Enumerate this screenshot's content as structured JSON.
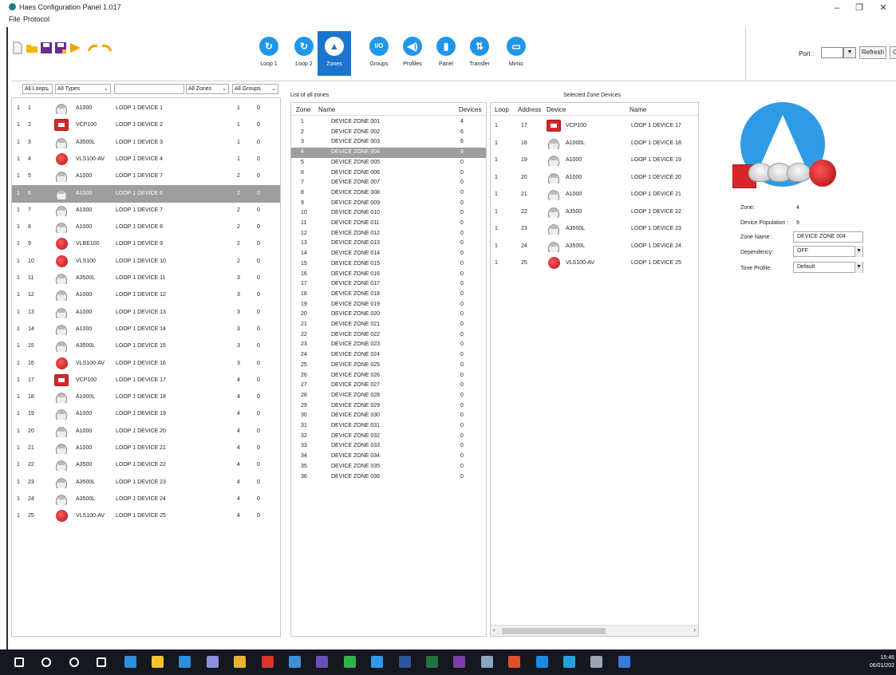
{
  "window": {
    "title": "Haes Configuration Panel 1.017",
    "minimize": "–",
    "maximize": "❐",
    "close": "✕"
  },
  "menu": [
    "File",
    "Protocol"
  ],
  "toolbar": {
    "nav": [
      {
        "label": "Loop 1",
        "icon": "refresh-icon",
        "glyph": "↻",
        "active": false
      },
      {
        "label": "Loop 2",
        "icon": "refresh-icon",
        "glyph": "↻",
        "active": false
      },
      {
        "label": "Zones",
        "icon": "triangle-icon",
        "glyph": "▲",
        "active": true
      },
      {
        "label": "Groups",
        "icon": "io-icon",
        "glyph": "I/O",
        "active": false
      },
      {
        "label": "Profiles",
        "icon": "speaker-icon",
        "glyph": "◀)",
        "active": false
      },
      {
        "label": "Panel",
        "icon": "panel-icon",
        "glyph": "▮",
        "active": false
      },
      {
        "label": "Transfer",
        "icon": "transfer-icon",
        "glyph": "⇅",
        "active": false
      },
      {
        "label": "Mimic",
        "icon": "mimic-icon",
        "glyph": "▭",
        "active": false
      }
    ],
    "port_label": "Port :",
    "port_value": "",
    "refresh_label": "Refresh",
    "connect_label": "Connect"
  },
  "filters": {
    "loops": "All Loops",
    "types": "All Types",
    "search": "",
    "zones": "All Zones",
    "groups": "All Groups"
  },
  "devices": [
    {
      "loop": "1",
      "address": "1",
      "type": "A1000",
      "icon": "detector",
      "name": "LOOP 1 DEVICE 1",
      "zone": "1",
      "group": "0"
    },
    {
      "loop": "1",
      "address": "2",
      "type": "VCP100",
      "icon": "callpoint",
      "name": "LOOP 1 DEVICE 2",
      "zone": "1",
      "group": "0"
    },
    {
      "loop": "1",
      "address": "3",
      "type": "A3500L",
      "icon": "detector",
      "name": "LOOP 1 DEVICE 3",
      "zone": "1",
      "group": "0"
    },
    {
      "loop": "1",
      "address": "4",
      "type": "VLS100-AV",
      "icon": "siren",
      "name": "LOOP 1 DEVICE 4",
      "zone": "1",
      "group": "0"
    },
    {
      "loop": "1",
      "address": "5",
      "type": "A1000",
      "icon": "detector",
      "name": "LOOP 1 DEVICE 7",
      "zone": "2",
      "group": "0"
    },
    {
      "loop": "1",
      "address": "6",
      "type": "A1000",
      "icon": "detector",
      "name": "LOOP 1 DEVICE 6",
      "zone": "2",
      "group": "0",
      "selected": true
    },
    {
      "loop": "1",
      "address": "7",
      "type": "A1000",
      "icon": "detector",
      "name": "LOOP 1 DEVICE 7",
      "zone": "2",
      "group": "0"
    },
    {
      "loop": "1",
      "address": "8",
      "type": "A1000",
      "icon": "detector",
      "name": "LOOP 1 DEVICE 8",
      "zone": "2",
      "group": "0"
    },
    {
      "loop": "1",
      "address": "9",
      "type": "VLBE100",
      "icon": "siren",
      "name": "LOOP 1 DEVICE 9",
      "zone": "2",
      "group": "0"
    },
    {
      "loop": "1",
      "address": "10",
      "type": "VLS100",
      "icon": "siren",
      "name": "LOOP 1 DEVICE 10",
      "zone": "2",
      "group": "0"
    },
    {
      "loop": "1",
      "address": "11",
      "type": "A3500L",
      "icon": "detector",
      "name": "LOOP 1 DEVICE 11",
      "zone": "3",
      "group": "0"
    },
    {
      "loop": "1",
      "address": "12",
      "type": "A1000",
      "icon": "detector",
      "name": "LOOP 1 DEVICE 12",
      "zone": "3",
      "group": "0"
    },
    {
      "loop": "1",
      "address": "13",
      "type": "A1000",
      "icon": "detector",
      "name": "LOOP 1 DEVICE 13",
      "zone": "3",
      "group": "0"
    },
    {
      "loop": "1",
      "address": "14",
      "type": "A1000",
      "icon": "detector",
      "name": "LOOP 1 DEVICE 14",
      "zone": "3",
      "group": "0"
    },
    {
      "loop": "1",
      "address": "15",
      "type": "A3500L",
      "icon": "detector",
      "name": "LOOP 1 DEVICE 15",
      "zone": "3",
      "group": "0"
    },
    {
      "loop": "1",
      "address": "16",
      "type": "VLS100-AV",
      "icon": "siren",
      "name": "LOOP 1 DEVICE 16",
      "zone": "3",
      "group": "0"
    },
    {
      "loop": "1",
      "address": "17",
      "type": "VCP100",
      "icon": "callpoint",
      "name": "LOOP 1 DEVICE 17",
      "zone": "4",
      "group": "0"
    },
    {
      "loop": "1",
      "address": "18",
      "type": "A1000L",
      "icon": "detector",
      "name": "LOOP 1 DEVICE 18",
      "zone": "4",
      "group": "0"
    },
    {
      "loop": "1",
      "address": "19",
      "type": "A1000",
      "icon": "detector",
      "name": "LOOP 1 DEVICE 19",
      "zone": "4",
      "group": "0"
    },
    {
      "loop": "1",
      "address": "20",
      "type": "A1000",
      "icon": "detector",
      "name": "LOOP 1 DEVICE 20",
      "zone": "4",
      "group": "0"
    },
    {
      "loop": "1",
      "address": "21",
      "type": "A1000",
      "icon": "detector",
      "name": "LOOP 1 DEVICE 21",
      "zone": "4",
      "group": "0"
    },
    {
      "loop": "1",
      "address": "22",
      "type": "A3500",
      "icon": "detector",
      "name": "LOOP 1 DEVICE 22",
      "zone": "4",
      "group": "0"
    },
    {
      "loop": "1",
      "address": "23",
      "type": "A3500L",
      "icon": "detector",
      "name": "LOOP 1 DEVICE 23",
      "zone": "4",
      "group": "0"
    },
    {
      "loop": "1",
      "address": "24",
      "type": "A3500L",
      "icon": "detector",
      "name": "LOOP 1 DEVICE 24",
      "zone": "4",
      "group": "0"
    },
    {
      "loop": "1",
      "address": "25",
      "type": "VLS100-AV",
      "icon": "siren",
      "name": "LOOP 1 DEVICE 25",
      "zone": "4",
      "group": "0"
    }
  ],
  "zones": {
    "caption": "List of all zones",
    "headers": {
      "zone": "Zone",
      "name": "Name",
      "devices": "Devices"
    },
    "selected_index": 3,
    "rows": [
      {
        "zone": "1",
        "name": "DEVICE ZONE 001",
        "devices": "4"
      },
      {
        "zone": "2",
        "name": "DEVICE ZONE 002",
        "devices": "6"
      },
      {
        "zone": "3",
        "name": "DEVICE ZONE 003",
        "devices": "6"
      },
      {
        "zone": "4",
        "name": "DEVICE ZONE 004",
        "devices": "9"
      },
      {
        "zone": "5",
        "name": "DEVICE ZONE 005",
        "devices": "0"
      },
      {
        "zone": "6",
        "name": "DEVICE ZONE 006",
        "devices": "0"
      },
      {
        "zone": "7",
        "name": "DEVICE ZONE 007",
        "devices": "0"
      },
      {
        "zone": "8",
        "name": "DEVICE ZONE 008",
        "devices": "0"
      },
      {
        "zone": "9",
        "name": "DEVICE ZONE 009",
        "devices": "0"
      },
      {
        "zone": "10",
        "name": "DEVICE ZONE 010",
        "devices": "0"
      },
      {
        "zone": "11",
        "name": "DEVICE ZONE 011",
        "devices": "0"
      },
      {
        "zone": "12",
        "name": "DEVICE ZONE 012",
        "devices": "0"
      },
      {
        "zone": "13",
        "name": "DEVICE ZONE 013",
        "devices": "0"
      },
      {
        "zone": "14",
        "name": "DEVICE ZONE 014",
        "devices": "0"
      },
      {
        "zone": "15",
        "name": "DEVICE ZONE 015",
        "devices": "0"
      },
      {
        "zone": "16",
        "name": "DEVICE ZONE 016",
        "devices": "0"
      },
      {
        "zone": "17",
        "name": "DEVICE ZONE 017",
        "devices": "0"
      },
      {
        "zone": "18",
        "name": "DEVICE ZONE 018",
        "devices": "0"
      },
      {
        "zone": "19",
        "name": "DEVICE ZONE 019",
        "devices": "0"
      },
      {
        "zone": "20",
        "name": "DEVICE ZONE 020",
        "devices": "0"
      },
      {
        "zone": "21",
        "name": "DEVICE ZONE 021",
        "devices": "0"
      },
      {
        "zone": "22",
        "name": "DEVICE ZONE 022",
        "devices": "0"
      },
      {
        "zone": "23",
        "name": "DEVICE ZONE 023",
        "devices": "0"
      },
      {
        "zone": "24",
        "name": "DEVICE ZONE 024",
        "devices": "0"
      },
      {
        "zone": "25",
        "name": "DEVICE ZONE 025",
        "devices": "0"
      },
      {
        "zone": "26",
        "name": "DEVICE ZONE 026",
        "devices": "0"
      },
      {
        "zone": "27",
        "name": "DEVICE ZONE 027",
        "devices": "0"
      },
      {
        "zone": "28",
        "name": "DEVICE ZONE 028",
        "devices": "0"
      },
      {
        "zone": "29",
        "name": "DEVICE ZONE 029",
        "devices": "0"
      },
      {
        "zone": "30",
        "name": "DEVICE ZONE 030",
        "devices": "0"
      },
      {
        "zone": "31",
        "name": "DEVICE ZONE 031",
        "devices": "0"
      },
      {
        "zone": "32",
        "name": "DEVICE ZONE 032",
        "devices": "0"
      },
      {
        "zone": "33",
        "name": "DEVICE ZONE 033",
        "devices": "0"
      },
      {
        "zone": "34",
        "name": "DEVICE ZONE 034",
        "devices": "0"
      },
      {
        "zone": "35",
        "name": "DEVICE ZONE 035",
        "devices": "0"
      },
      {
        "zone": "36",
        "name": "DEVICE ZONE 036",
        "devices": "0"
      }
    ]
  },
  "zone_devices": {
    "caption": "Selected Zone Devices",
    "headers": {
      "loop": "Loop",
      "address": "Address",
      "device": "Device",
      "name": "Name"
    },
    "rows": [
      {
        "loop": "1",
        "address": "17",
        "device": "VCP100",
        "icon": "callpoint",
        "name": "LOOP 1 DEVICE 17"
      },
      {
        "loop": "1",
        "address": "18",
        "device": "A1000L",
        "icon": "detector",
        "name": "LOOP 1 DEVICE 18"
      },
      {
        "loop": "1",
        "address": "19",
        "device": "A1000",
        "icon": "detector",
        "name": "LOOP 1 DEVICE 19"
      },
      {
        "loop": "1",
        "address": "20",
        "device": "A1000",
        "icon": "detector",
        "name": "LOOP 1 DEVICE 20"
      },
      {
        "loop": "1",
        "address": "21",
        "device": "A1000",
        "icon": "detector",
        "name": "LOOP 1 DEVICE 21"
      },
      {
        "loop": "1",
        "address": "22",
        "device": "A3500",
        "icon": "detector",
        "name": "LOOP 1 DEVICE 22"
      },
      {
        "loop": "1",
        "address": "23",
        "device": "A3500L",
        "icon": "detector",
        "name": "LOOP 1 DEVICE 23"
      },
      {
        "loop": "1",
        "address": "24",
        "device": "A3500L",
        "icon": "detector",
        "name": "LOOP 1 DEVICE 24"
      },
      {
        "loop": "1",
        "address": "25",
        "device": "VLS100-AV",
        "icon": "siren",
        "name": "LOOP 1 DEVICE 25"
      }
    ]
  },
  "details": {
    "zone_label": "Zone:",
    "zone_value": "4",
    "population_label": "Device Population :",
    "population_value": "9",
    "zone_name_label": "Zone Name :",
    "zone_name_value": "DEVICE ZONE 004",
    "dependency_label": "Dependency:",
    "dependency_value": "OFF",
    "tone_label": "Tone Profile:",
    "tone_value": "Default"
  },
  "taskbar": {
    "time": "15:46",
    "date": "06/01/202",
    "icons": [
      {
        "name": "windows-start-icon",
        "color": "#ffffff"
      },
      {
        "name": "search-icon",
        "color": "#ffffff"
      },
      {
        "name": "cortana-icon",
        "color": "#ffffff"
      },
      {
        "name": "task-view-icon",
        "color": "#ffffff"
      },
      {
        "name": "edge-icon",
        "color": "#2f8fe0"
      },
      {
        "name": "file-explorer-icon",
        "color": "#f2c230"
      },
      {
        "name": "mail-icon",
        "color": "#2f8fe0"
      },
      {
        "name": "teams-icon",
        "color": "#8a8fd8"
      },
      {
        "name": "chrome-icon",
        "color": "#e9b52c"
      },
      {
        "name": "acrobat-icon",
        "color": "#e0312b"
      },
      {
        "name": "network-icon",
        "color": "#3c8fd9"
      },
      {
        "name": "app-icon",
        "color": "#6b4fb8"
      },
      {
        "name": "whatsapp-icon",
        "color": "#2fb24a"
      },
      {
        "name": "haes-icon",
        "color": "#2f9be6"
      },
      {
        "name": "word-icon",
        "color": "#2b579a"
      },
      {
        "name": "excel-icon",
        "color": "#217346"
      },
      {
        "name": "onenote-icon",
        "color": "#7b3fa6"
      },
      {
        "name": "paint-icon",
        "color": "#8aa4c4"
      },
      {
        "name": "office-icon",
        "color": "#e0512b"
      },
      {
        "name": "outlook-icon",
        "color": "#1e88e5"
      },
      {
        "name": "skype-icon",
        "color": "#1fa3dd"
      },
      {
        "name": "tools-icon",
        "color": "#9aa5b1"
      },
      {
        "name": "window-icon",
        "color": "#3c78d8"
      }
    ]
  },
  "colors": {
    "accent": "#2196e8",
    "active_tab": "#1a75cf",
    "selection": "#9e9e9e",
    "alarm_red": "#d7262b"
  }
}
